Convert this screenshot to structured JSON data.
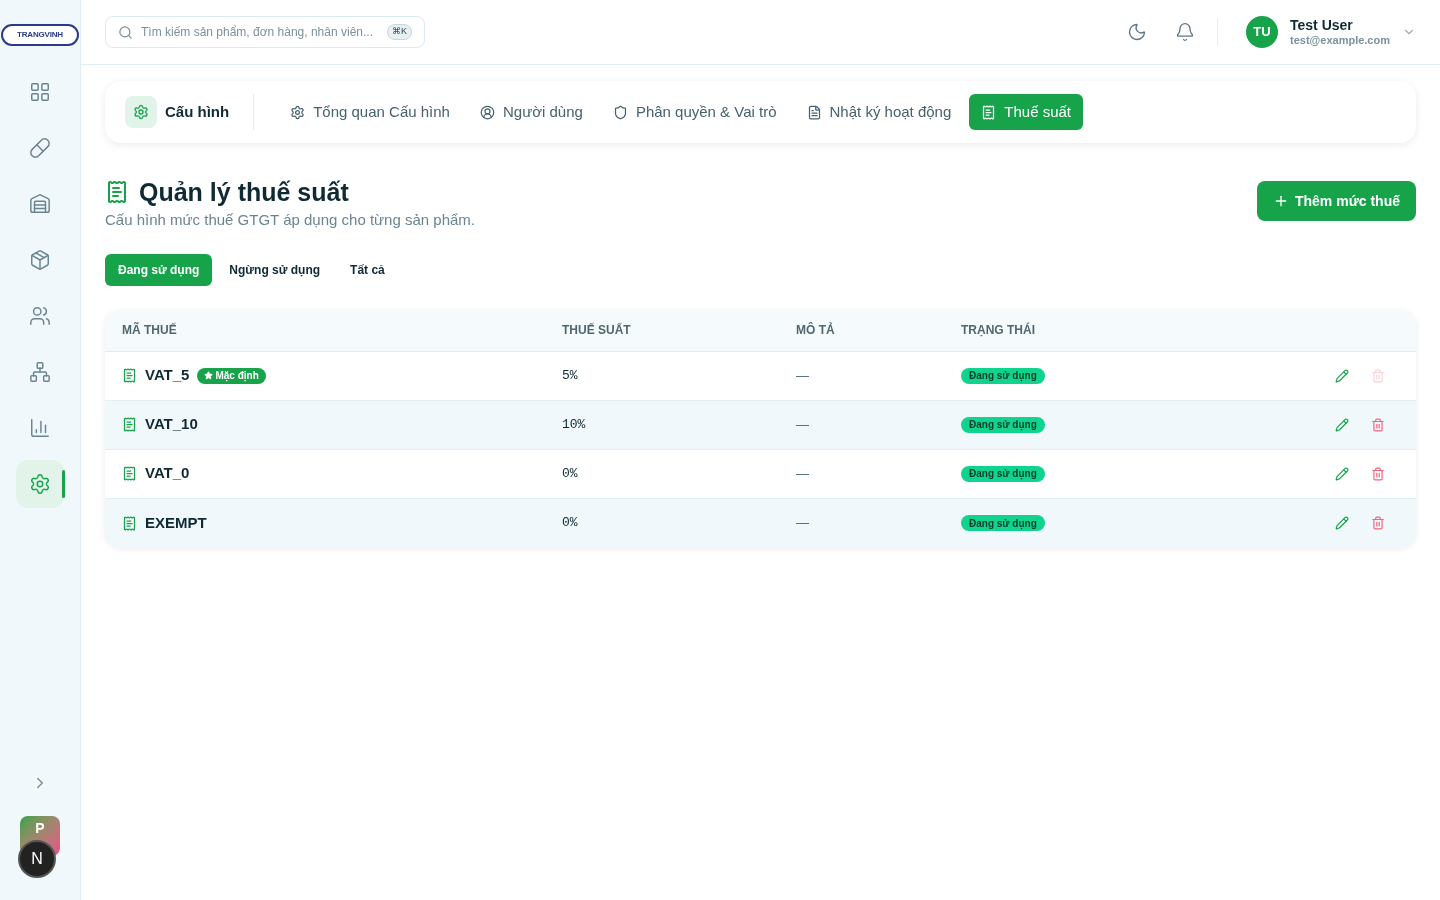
{
  "logo": {
    "text": "TRANGVINH"
  },
  "sidebar": {
    "items": [
      {
        "selected": false
      },
      {
        "selected": false
      },
      {
        "selected": false
      },
      {
        "selected": false
      },
      {
        "selected": false
      },
      {
        "selected": false
      },
      {
        "selected": false
      },
      {
        "selected": true
      }
    ]
  },
  "bottom": {
    "avatar": "P",
    "dev_badge": "N"
  },
  "search": {
    "placeholder": "Tìm kiếm sản phẩm, đơn hàng, nhân viên...",
    "shortcut": "⌘K"
  },
  "user": {
    "initials": "TU",
    "name": "Test User",
    "email": "test@example.com"
  },
  "config_nav": {
    "title": "Cấu hình",
    "tabs": [
      {
        "label": "Tổng quan Cấu hình",
        "selected": false
      },
      {
        "label": "Người dùng",
        "selected": false
      },
      {
        "label": "Phân quyền & Vai trò",
        "selected": false
      },
      {
        "label": "Nhật ký hoạt động",
        "selected": false
      },
      {
        "label": "Thuế suất",
        "selected": true
      }
    ]
  },
  "header": {
    "title": "Quản lý thuế suất",
    "subtitle": "Cấu hình mức thuế GTGT áp dụng cho từng sản phẩm.",
    "add_button": "Thêm mức thuế"
  },
  "filters": [
    {
      "label": "Đang sử dụng",
      "selected": true
    },
    {
      "label": "Ngừng sử dụng",
      "selected": false
    },
    {
      "label": "Tất cả",
      "selected": false
    }
  ],
  "table": {
    "columns": [
      "MÃ THUẾ",
      "THUẾ SUẤT",
      "MÔ TẢ",
      "TRẠNG THÁI"
    ],
    "rows": [
      {
        "code": "VAT_5",
        "badge": "Mặc định",
        "rate": "5%",
        "description": "—",
        "status": "Đang sử dụng",
        "delete_disabled": true
      },
      {
        "code": "VAT_10",
        "rate": "10%",
        "description": "—",
        "status": "Đang sử dụng",
        "delete_disabled": false
      },
      {
        "code": "VAT_0",
        "rate": "0%",
        "description": "—",
        "status": "Đang sử dụng",
        "delete_disabled": false
      },
      {
        "code": "EXEMPT",
        "rate": "0%",
        "description": "—",
        "status": "Đang sử dụng",
        "delete_disabled": false
      }
    ]
  }
}
